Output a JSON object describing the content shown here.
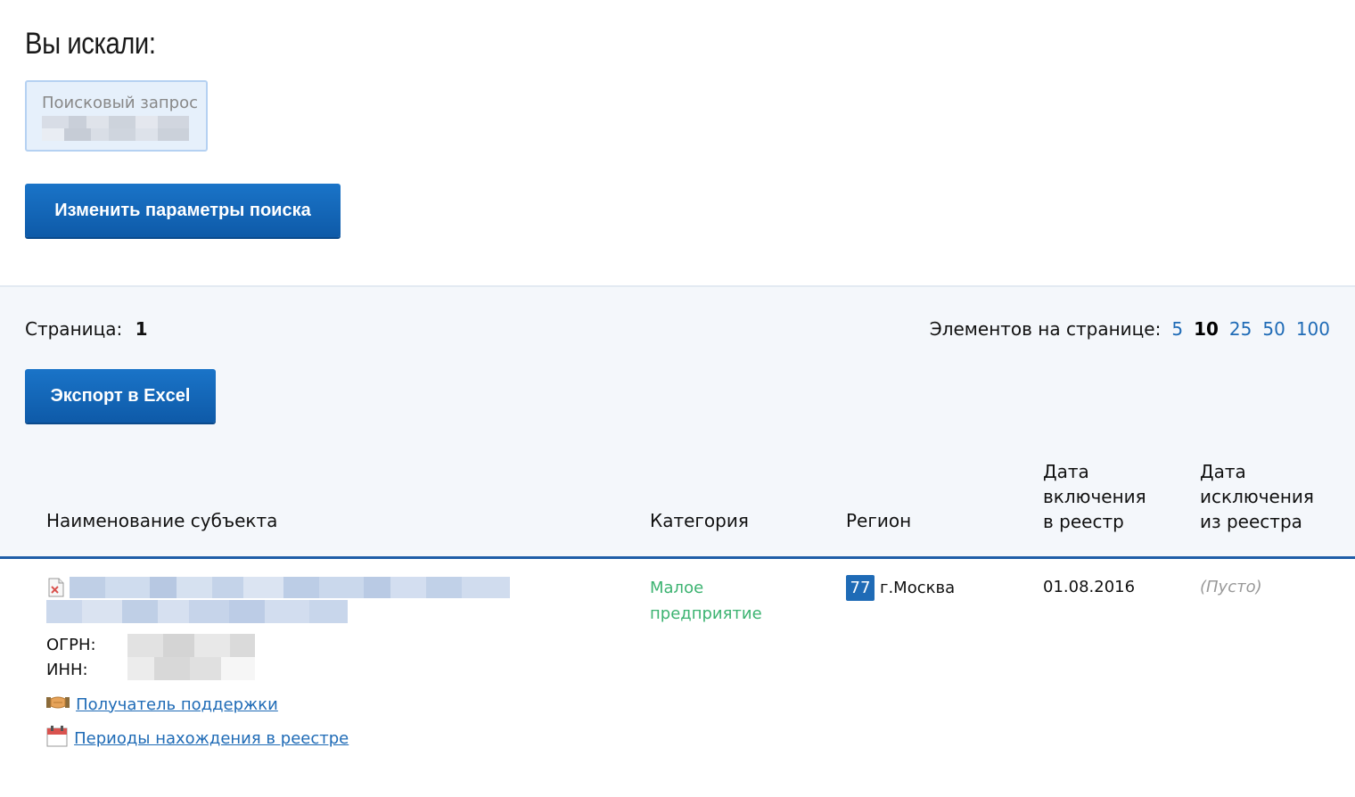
{
  "search": {
    "title": "Вы искали:",
    "query_label": "Поисковый запрос",
    "change_button": "Изменить параметры поиска"
  },
  "pagination": {
    "page_label": "Страница:",
    "page_number": "1",
    "per_page_label": "Элементов на странице:",
    "options": [
      "5",
      "10",
      "25",
      "50",
      "100"
    ],
    "selected": "10"
  },
  "export_button": "Экспорт в Excel",
  "table": {
    "headers": {
      "name": "Наименование субъекта",
      "category": "Категория",
      "region": "Регион",
      "date_in_1": "Дата",
      "date_in_2": "включения",
      "date_in_3": "в реестр",
      "date_out_1": "Дата",
      "date_out_2": "исключения",
      "date_out_3": "из реестра"
    },
    "rows": [
      {
        "ogrn_label": "ОГРН:",
        "inn_label": "ИНН:",
        "category_1": "Малое",
        "category_2": "предприятие",
        "region_code": "77",
        "region_name": "г.Москва",
        "date_in": "01.08.2016",
        "date_out": "(Пусто)",
        "support_link": "Получатель поддержки",
        "periods_link": "Периоды нахождения в реестре"
      }
    ]
  },
  "colors": {
    "accent": "#1f6bb6",
    "category_green": "#3cb371",
    "button_blue": "#0e5aa8"
  }
}
